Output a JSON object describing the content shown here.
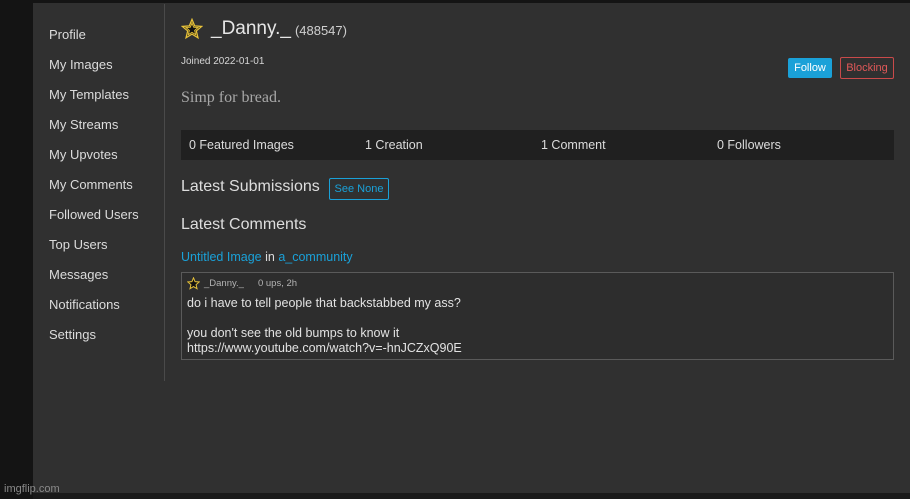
{
  "sidebar": {
    "items": [
      {
        "label": "Profile"
      },
      {
        "label": "My Images"
      },
      {
        "label": "My Templates"
      },
      {
        "label": "My Streams"
      },
      {
        "label": "My Upvotes"
      },
      {
        "label": "My Comments"
      },
      {
        "label": "Followed Users"
      },
      {
        "label": "Top Users"
      },
      {
        "label": "Messages"
      },
      {
        "label": "Notifications"
      },
      {
        "label": "Settings"
      }
    ]
  },
  "profile": {
    "username": "_Danny._",
    "user_id": "(488547)",
    "joined": "Joined 2022-01-01",
    "bio": "Simp for bread.",
    "badge_icon": "star-icon",
    "follow_label": "Follow",
    "blocking_label": "Blocking"
  },
  "stats": [
    {
      "label": "0 Featured Images"
    },
    {
      "label": "1 Creation"
    },
    {
      "label": "1 Comment"
    },
    {
      "label": "0 Followers"
    }
  ],
  "submissions": {
    "title": "Latest Submissions",
    "see_none_label": "See None"
  },
  "comments_section": {
    "title": "Latest Comments",
    "image_link": "Untitled Image",
    "in_text": "in",
    "community_link": "a_community"
  },
  "comment": {
    "author": "_Danny._",
    "meta": "0 ups, 2h",
    "line1": "do i have to tell people that backstabbed my ass?",
    "line2": "you don't see the old bumps to know it",
    "line3": "https://www.youtube.com/watch?v=-hnJCZxQ90E"
  },
  "watermark": "imgflip.com",
  "colors": {
    "accent": "#1aa1d8",
    "danger": "#c94a4a",
    "background": "#303030",
    "stats_bar": "#202020"
  }
}
